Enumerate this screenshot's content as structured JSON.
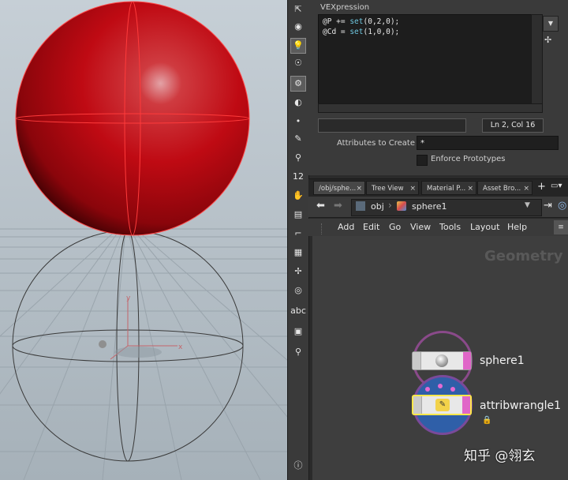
{
  "viewport": {
    "sphere_color": "#c00a12",
    "handle_x_label": "x",
    "handle_y_label": "y"
  },
  "toolbar": {
    "tools": [
      {
        "icon": "select-icon",
        "glyph": "⇱"
      },
      {
        "icon": "camera-icon",
        "glyph": "◉"
      },
      {
        "icon": "light-icon",
        "glyph": "💡"
      },
      {
        "icon": "display-icon",
        "glyph": "☉"
      },
      {
        "icon": "snap-icon",
        "glyph": "⚙"
      },
      {
        "icon": "visibility-icon",
        "glyph": "◐"
      },
      {
        "icon": "point-icon",
        "glyph": "•"
      },
      {
        "icon": "brush-icon",
        "glyph": "✎"
      },
      {
        "icon": "pin-icon",
        "glyph": "⚲"
      },
      {
        "icon": "number-icon",
        "glyph": "12"
      },
      {
        "icon": "paint-icon",
        "glyph": "✋"
      },
      {
        "icon": "document-icon",
        "glyph": "▤"
      },
      {
        "icon": "corner-icon",
        "glyph": "⌐"
      },
      {
        "icon": "grid-icon",
        "glyph": "▦"
      },
      {
        "icon": "transform-icon",
        "glyph": "✢"
      },
      {
        "icon": "circle-icon",
        "glyph": "◎"
      },
      {
        "icon": "text-icon",
        "glyph": "abc"
      },
      {
        "icon": "image-icon",
        "glyph": "▣"
      },
      {
        "icon": "bulb-icon",
        "glyph": "⚲"
      },
      {
        "icon": "info-icon",
        "glyph": "ⓘ"
      }
    ]
  },
  "params": {
    "vex_label": "VEXpression",
    "code": {
      "line1_a": "@P += ",
      "line1_kw": "set",
      "line1_b": "(0,2,0);",
      "line2_a": "@Cd = ",
      "line2_kw": "set",
      "line2_b": "(1,0,0);"
    },
    "cursor_status": "Ln 2, Col 16",
    "attr_label": "Attributes to Create",
    "attr_value": "*",
    "enforce_label": "Enforce Prototypes",
    "enforce_checked": false
  },
  "network": {
    "tabs": [
      {
        "label": "/obj/sphe...",
        "active": true
      },
      {
        "label": "Tree View",
        "active": false
      },
      {
        "label": "Material P...",
        "active": false
      },
      {
        "label": "Asset Bro...",
        "active": false
      }
    ],
    "path": {
      "root": "obj",
      "node": "sphere1"
    },
    "menu": [
      "Add",
      "Edit",
      "Go",
      "View",
      "Tools",
      "Layout",
      "Help"
    ],
    "context_label": "Geometry",
    "nodes": [
      {
        "name": "sphere1",
        "type": "sphere"
      },
      {
        "name": "attribwrangle1",
        "type": "attribwrangle"
      }
    ]
  },
  "watermark": "知乎 @翎玄"
}
